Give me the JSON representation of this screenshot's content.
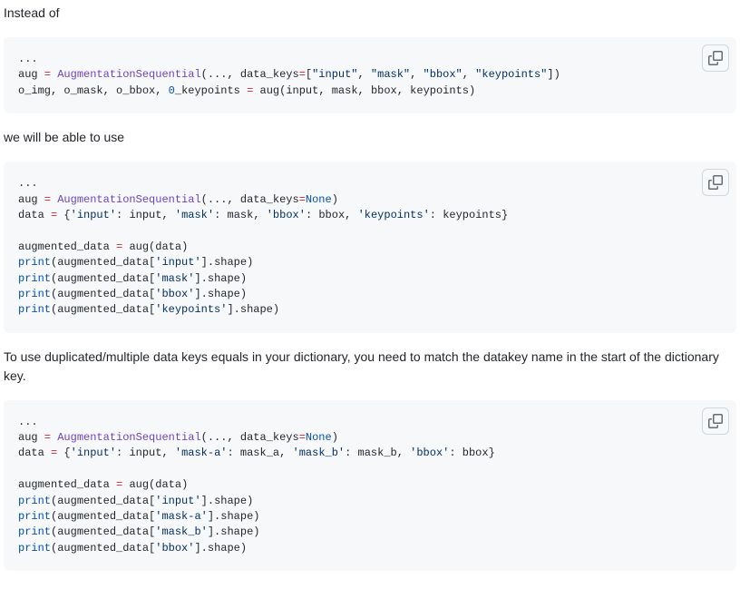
{
  "paragraphs": {
    "p1": "Instead of",
    "p2": "we will be able to use",
    "p3": "To use duplicated/multiple data keys equals in your dictionary, you need to match the datakey name in the start of the dictionary key."
  },
  "code": {
    "block1": {
      "l1_dots": "...",
      "l2_aug": "aug",
      "l2_eq": "=",
      "l2_fn": "AugmentationSequential",
      "l2_open": "(",
      "l2_ell": "...",
      "l2_comma1": ", ",
      "l2_kw": "data_keys",
      "l2_eq2": "=",
      "l2_br_open": "[",
      "l2_s1": "\"input\"",
      "l2_c1": ", ",
      "l2_s2": "\"mask\"",
      "l2_c2": ", ",
      "l2_s3": "\"bbox\"",
      "l2_c3": ", ",
      "l2_s4": "\"keypoints\"",
      "l2_close": "])",
      "l3_lhs1": "o_img",
      "l3_c1": ", ",
      "l3_lhs2": "o_mask",
      "l3_c2": ", ",
      "l3_lhs3": "o_bbox",
      "l3_c3": ", ",
      "l3_zero": "0",
      "l3_under": "_keypoints",
      "l3_sp": " ",
      "l3_eq": "=",
      "l3_sp2": " ",
      "l3_call": "aug",
      "l3_open": "(",
      "l3_a1": "input",
      "l3_ac1": ", ",
      "l3_a2": "mask",
      "l3_ac2": ", ",
      "l3_a3": "bbox",
      "l3_ac3": ", ",
      "l3_a4": "keypoints",
      "l3_close": ")"
    },
    "block2": {
      "l1_dots": "...",
      "l2_aug": "aug",
      "l2_eq": "=",
      "l2_fn": "AugmentationSequential",
      "l2_open": "(",
      "l2_ell": "...",
      "l2_comma": ", ",
      "l2_kw": "data_keys",
      "l2_eq2": "=",
      "l2_none": "None",
      "l2_close": ")",
      "l3_data": "data",
      "l3_eq": "=",
      "l3_open": "{",
      "l3_k1": "'input'",
      "l3_colon1": ": ",
      "l3_v1": "input",
      "l3_c1": ", ",
      "l3_k2": "'mask'",
      "l3_colon2": ": ",
      "l3_v2": "mask",
      "l3_c2": ", ",
      "l3_k3": "'bbox'",
      "l3_colon3": ": ",
      "l3_v3": "bbox",
      "l3_c3": ", ",
      "l3_k4": "'keypoints'",
      "l3_colon4": ": ",
      "l3_v4": "keypoints",
      "l3_close": "}",
      "l5_lhs": "augmented_data",
      "l5_eq": "=",
      "l5_call": "aug",
      "l5_open": "(",
      "l5_arg": "data",
      "l5_close": ")",
      "print": "print",
      "p1_open": "(",
      "p1_obj": "augmented_data",
      "p1_br": "[",
      "p1_key": "'input'",
      "p1_br2": "].",
      "p1_attr": "shape",
      "p1_close": ")",
      "p2_key": "'mask'",
      "p3_key": "'bbox'",
      "p4_key": "'keypoints'"
    },
    "block3": {
      "l1_dots": "...",
      "l2_aug": "aug",
      "l2_eq": "=",
      "l2_fn": "AugmentationSequential",
      "l2_open": "(",
      "l2_ell": "...",
      "l2_comma": ", ",
      "l2_kw": "data_keys",
      "l2_eq2": "=",
      "l2_none": "None",
      "l2_close": ")",
      "l3_data": "data",
      "l3_eq": "=",
      "l3_open": "{",
      "l3_k1": "'input'",
      "l3_v1": "input",
      "l3_k2": "'mask-a'",
      "l3_v2": "mask_a",
      "l3_k3": "'mask_b'",
      "l3_v3": "mask_b",
      "l3_k4": "'bbox'",
      "l3_v4": "bbox",
      "l3_close": "}",
      "colon": ": ",
      "comma": ", ",
      "l5_lhs": "augmented_data",
      "l5_eq": "=",
      "l5_call": "aug",
      "l5_open": "(",
      "l5_arg": "data",
      "l5_close": ")",
      "print": "print",
      "p_open": "(",
      "p_obj": "augmented_data",
      "p_br": "[",
      "p_br2": "].",
      "p_attr": "shape",
      "p_close": ")",
      "p1_key": "'input'",
      "p2_key": "'mask-a'",
      "p3_key": "'mask_b'",
      "p4_key": "'bbox'"
    }
  },
  "icons": {
    "copy": "copy-icon"
  }
}
